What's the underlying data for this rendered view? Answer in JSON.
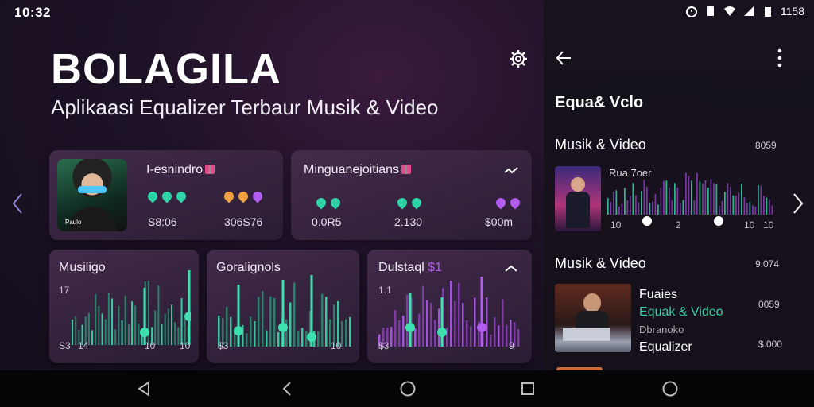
{
  "status_bar": {
    "time": "10:32",
    "battery_text": "1158"
  },
  "app": {
    "title": "BOLAGILA",
    "subtitle": "Aplikaasi Equalizer Terbaur Musik & Video"
  },
  "cards": {
    "profile": {
      "title": "I-esnindro",
      "avatar_label": "Paulo",
      "stat_left": "S8:06",
      "stat_right": "306S76"
    },
    "mingu": {
      "title": "Minguanejoitians",
      "stats": [
        "0.0R5",
        "2.130",
        "$00m"
      ]
    },
    "musik": {
      "title": "Musiligo",
      "top_label": "17",
      "labels": [
        "S3",
        "14",
        "10",
        "10"
      ]
    },
    "gorali": {
      "title": "Goralignols",
      "labels": [
        "$3",
        "10"
      ]
    },
    "dulstaq": {
      "title": "Dulstaql",
      "title_suffix": "$1",
      "top_label": "1.1",
      "labels": [
        "$3",
        "9"
      ]
    }
  },
  "right_panel": {
    "header": "Equa& Vclo",
    "section1": {
      "title": "Musik & Video",
      "value": "8059",
      "track": "Rua 7oer",
      "scale": [
        "10",
        "2",
        "10",
        "10"
      ]
    },
    "section2": {
      "title": "Musik & Video",
      "value": "9.074",
      "lines": [
        "Fuaies",
        "Equak & Video",
        "Dbranoko",
        "Equalizer"
      ],
      "line_values": [
        "0059",
        "$.000"
      ]
    }
  },
  "colors": {
    "accent_teal": "#2fd4a6",
    "accent_violet": "#b35cf0",
    "accent_orange": "#f0a040",
    "background": "#140d1b"
  }
}
